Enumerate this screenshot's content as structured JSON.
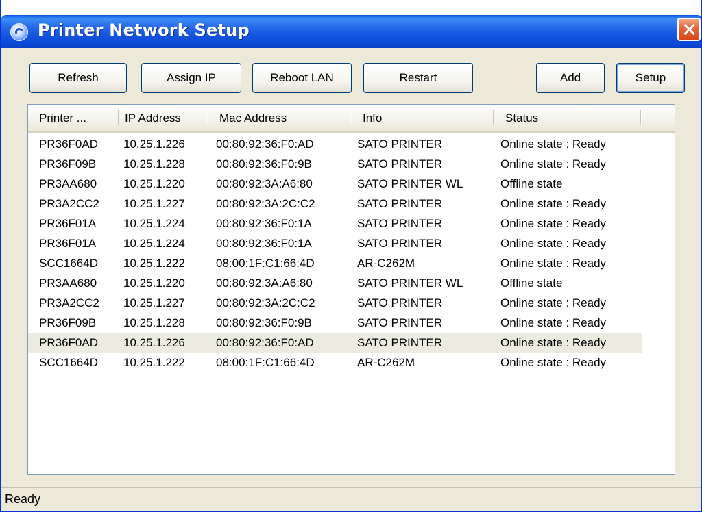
{
  "window": {
    "title": "Printer Network Setup",
    "close_icon": "close-icon"
  },
  "toolbar": {
    "refresh": "Refresh",
    "assign_ip": "Assign IP",
    "reboot_lan": "Reboot LAN",
    "restart": "Restart",
    "add": "Add",
    "setup": "Setup"
  },
  "table": {
    "columns": [
      "Printer ...",
      "IP Address",
      "Mac Address",
      "Info",
      "Status"
    ],
    "rows": [
      [
        "PR36F0AD",
        "10.25.1.226",
        "00:80:92:36:F0:AD",
        "SATO PRINTER",
        "Online state : Ready"
      ],
      [
        "PR36F09B",
        "10.25.1.228",
        "00:80:92:36:F0:9B",
        "SATO PRINTER",
        "Online state : Ready"
      ],
      [
        "PR3AA680",
        "10.25.1.220",
        "00:80:92:3A:A6:80",
        "SATO PRINTER WL",
        "Offline state"
      ],
      [
        "PR3A2CC2",
        "10.25.1.227",
        "00:80:92:3A:2C:C2",
        "SATO PRINTER",
        "Online state : Ready"
      ],
      [
        "PR36F01A",
        "10.25.1.224",
        "00:80:92:36:F0:1A",
        "SATO PRINTER",
        "Online state : Ready"
      ],
      [
        "PR36F01A",
        "10.25.1.224",
        "00:80:92:36:F0:1A",
        "SATO PRINTER",
        "Online state : Ready"
      ],
      [
        "SCC1664D",
        "10.25.1.222",
        "08:00:1F:C1:66:4D",
        "AR-C262M",
        "Online state : Ready"
      ],
      [
        "PR3AA680",
        "10.25.1.220",
        "00:80:92:3A:A6:80",
        "SATO PRINTER WL",
        "Offline state"
      ],
      [
        "PR3A2CC2",
        "10.25.1.227",
        "00:80:92:3A:2C:C2",
        "SATO PRINTER",
        "Online state : Ready"
      ],
      [
        "PR36F09B",
        "10.25.1.228",
        "00:80:92:36:F0:9B",
        "SATO PRINTER",
        "Online state : Ready"
      ],
      [
        "PR36F0AD",
        "10.25.1.226",
        "00:80:92:36:F0:AD",
        "SATO PRINTER",
        "Online state : Ready"
      ],
      [
        "SCC1664D",
        "10.25.1.222",
        "08:00:1F:C1:66:4D",
        "AR-C262M",
        "Online state : Ready"
      ]
    ],
    "selected_row": 10
  },
  "statusbar": {
    "text": "Ready"
  },
  "colors": {
    "titlebar_blue": "#0b48d4",
    "close_red": "#d9481d",
    "window_bg": "#ece9d8",
    "selected_row_bg": "#ecebe0"
  }
}
